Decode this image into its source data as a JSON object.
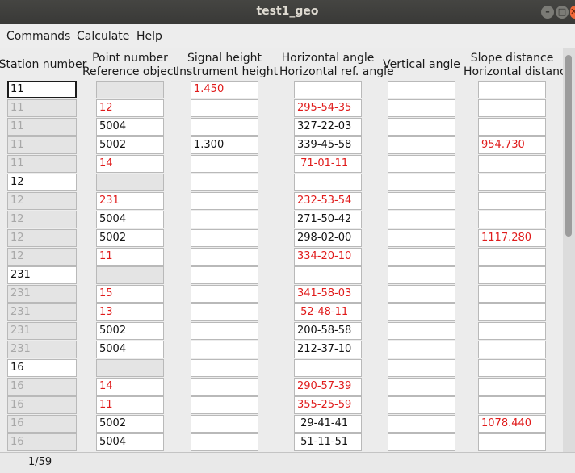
{
  "window": {
    "title": "test1_geo",
    "minimize": "–",
    "maximize": "□",
    "close": "✕"
  },
  "menu": [
    "Commands",
    "Calculate",
    "Help"
  ],
  "headers": [
    [
      "Station number",
      ""
    ],
    [
      "Point number",
      "Reference object"
    ],
    [
      "Signal height",
      "Instrument height"
    ],
    [
      "Horizontal angle",
      "Horizontal ref. angle"
    ],
    [
      "Vertical angle",
      ""
    ],
    [
      "Slope distance",
      "Horizontal distance"
    ]
  ],
  "rows": [
    {
      "station": "11",
      "station_mode": "active",
      "point": "",
      "point_grey": true,
      "point_red": false,
      "signal": "1.450",
      "signal_red": true,
      "hangle": "",
      "hangle_red": false,
      "vangle": "",
      "dist": "",
      "dist_red": false
    },
    {
      "station": "11",
      "station_mode": "grey",
      "point": "12",
      "point_grey": false,
      "point_red": true,
      "signal": "",
      "signal_red": false,
      "hangle": "295-54-35",
      "hangle_red": true,
      "vangle": "",
      "dist": "",
      "dist_red": false
    },
    {
      "station": "11",
      "station_mode": "grey",
      "point": "5004",
      "point_grey": false,
      "point_red": false,
      "signal": "",
      "signal_red": false,
      "hangle": "327-22-03",
      "hangle_red": false,
      "vangle": "",
      "dist": "",
      "dist_red": false
    },
    {
      "station": "11",
      "station_mode": "grey",
      "point": "5002",
      "point_grey": false,
      "point_red": false,
      "signal": "1.300",
      "signal_red": false,
      "hangle": "339-45-58",
      "hangle_red": false,
      "vangle": "",
      "dist": "954.730",
      "dist_red": true
    },
    {
      "station": "11",
      "station_mode": "grey",
      "point": "14",
      "point_grey": false,
      "point_red": true,
      "signal": "",
      "signal_red": false,
      "hangle": " 71-01-11",
      "hangle_red": true,
      "vangle": "",
      "dist": "",
      "dist_red": false
    },
    {
      "station": "12",
      "station_mode": "white",
      "point": "",
      "point_grey": true,
      "point_red": false,
      "signal": "",
      "signal_red": false,
      "hangle": "",
      "hangle_red": false,
      "vangle": "",
      "dist": "",
      "dist_red": false
    },
    {
      "station": "12",
      "station_mode": "grey",
      "point": "231",
      "point_grey": false,
      "point_red": true,
      "signal": "",
      "signal_red": false,
      "hangle": "232-53-54",
      "hangle_red": true,
      "vangle": "",
      "dist": "",
      "dist_red": false
    },
    {
      "station": "12",
      "station_mode": "grey",
      "point": "5004",
      "point_grey": false,
      "point_red": false,
      "signal": "",
      "signal_red": false,
      "hangle": "271-50-42",
      "hangle_red": false,
      "vangle": "",
      "dist": "",
      "dist_red": false
    },
    {
      "station": "12",
      "station_mode": "grey",
      "point": "5002",
      "point_grey": false,
      "point_red": false,
      "signal": "",
      "signal_red": false,
      "hangle": "298-02-00",
      "hangle_red": false,
      "vangle": "",
      "dist": "1117.280",
      "dist_red": true
    },
    {
      "station": "12",
      "station_mode": "grey",
      "point": "11",
      "point_grey": false,
      "point_red": true,
      "signal": "",
      "signal_red": false,
      "hangle": "334-20-10",
      "hangle_red": true,
      "vangle": "",
      "dist": "",
      "dist_red": false
    },
    {
      "station": "231",
      "station_mode": "white",
      "point": "",
      "point_grey": true,
      "point_red": false,
      "signal": "",
      "signal_red": false,
      "hangle": "",
      "hangle_red": false,
      "vangle": "",
      "dist": "",
      "dist_red": false
    },
    {
      "station": "231",
      "station_mode": "grey",
      "point": "15",
      "point_grey": false,
      "point_red": true,
      "signal": "",
      "signal_red": false,
      "hangle": "341-58-03",
      "hangle_red": true,
      "vangle": "",
      "dist": "",
      "dist_red": false
    },
    {
      "station": "231",
      "station_mode": "grey",
      "point": "13",
      "point_grey": false,
      "point_red": true,
      "signal": "",
      "signal_red": false,
      "hangle": " 52-48-11",
      "hangle_red": true,
      "vangle": "",
      "dist": "",
      "dist_red": false
    },
    {
      "station": "231",
      "station_mode": "grey",
      "point": "5002",
      "point_grey": false,
      "point_red": false,
      "signal": "",
      "signal_red": false,
      "hangle": "200-58-58",
      "hangle_red": false,
      "vangle": "",
      "dist": "",
      "dist_red": false
    },
    {
      "station": "231",
      "station_mode": "grey",
      "point": "5004",
      "point_grey": false,
      "point_red": false,
      "signal": "",
      "signal_red": false,
      "hangle": "212-37-10",
      "hangle_red": false,
      "vangle": "",
      "dist": "",
      "dist_red": false
    },
    {
      "station": "16",
      "station_mode": "white",
      "point": "",
      "point_grey": true,
      "point_red": false,
      "signal": "",
      "signal_red": false,
      "hangle": "",
      "hangle_red": false,
      "vangle": "",
      "dist": "",
      "dist_red": false
    },
    {
      "station": "16",
      "station_mode": "grey",
      "point": "14",
      "point_grey": false,
      "point_red": true,
      "signal": "",
      "signal_red": false,
      "hangle": "290-57-39",
      "hangle_red": true,
      "vangle": "",
      "dist": "",
      "dist_red": false
    },
    {
      "station": "16",
      "station_mode": "grey",
      "point": "11",
      "point_grey": false,
      "point_red": true,
      "signal": "",
      "signal_red": false,
      "hangle": "355-25-59",
      "hangle_red": true,
      "vangle": "",
      "dist": "",
      "dist_red": false
    },
    {
      "station": "16",
      "station_mode": "grey",
      "point": "5002",
      "point_grey": false,
      "point_red": false,
      "signal": "",
      "signal_red": false,
      "hangle": " 29-41-41",
      "hangle_red": false,
      "vangle": "",
      "dist": "1078.440",
      "dist_red": true
    },
    {
      "station": "16",
      "station_mode": "grey",
      "point": "5004",
      "point_grey": false,
      "point_red": false,
      "signal": "",
      "signal_red": false,
      "hangle": " 51-11-51",
      "hangle_red": false,
      "vangle": "",
      "dist": "",
      "dist_red": false
    }
  ],
  "status": {
    "position": "1/59"
  }
}
